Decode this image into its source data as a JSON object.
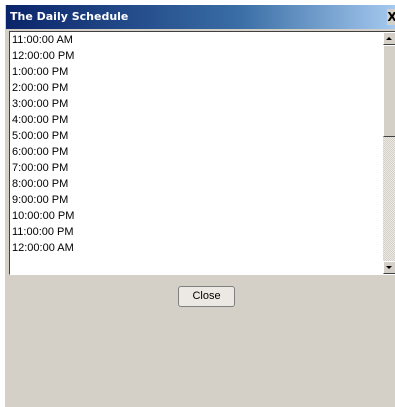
{
  "window": {
    "title": "The Daily Schedule",
    "close_glyph": "X"
  },
  "schedule": {
    "times": [
      "11:00:00 AM",
      "12:00:00 PM",
      "1:00:00 PM",
      "2:00:00 PM",
      "3:00:00 PM",
      "4:00:00 PM",
      "5:00:00 PM",
      "6:00:00 PM",
      "7:00:00 PM",
      "8:00:00 PM",
      "9:00:00 PM",
      "10:00:00 PM",
      "11:00:00 PM",
      "12:00:00 AM"
    ]
  },
  "footer": {
    "close_label": "Close"
  },
  "icons": {
    "title_close": "close-icon",
    "scroll_up": "arrow-up-icon",
    "scroll_down": "arrow-down-icon"
  },
  "colors": {
    "titlebar_start": "#0a246a",
    "titlebar_end": "#a6caf0",
    "dialog_background": "#d4d0c8",
    "list_background": "#ffffff"
  }
}
